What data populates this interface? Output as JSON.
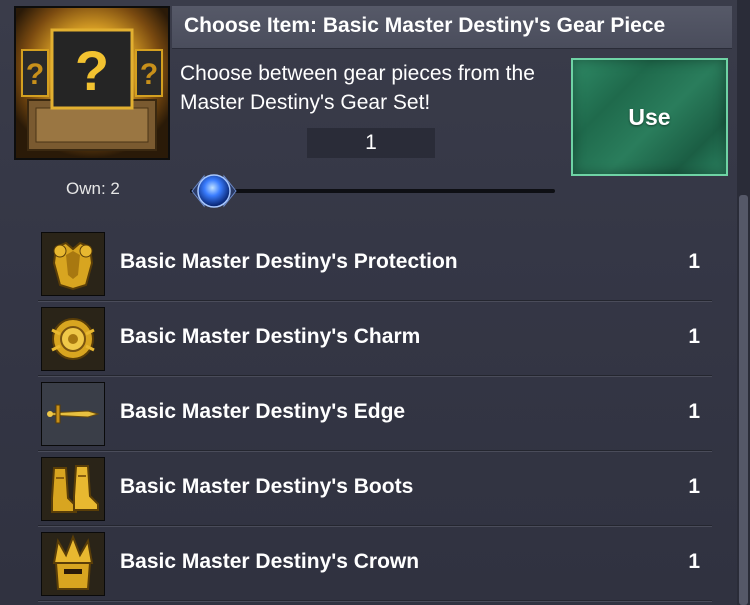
{
  "header": {
    "title": "Choose Item: Basic Master Destiny's Gear Piece"
  },
  "description": "Choose between gear pieces from the Master Destiny's Gear Set!",
  "quantity": "1",
  "use_button": {
    "label": "Use"
  },
  "own": {
    "label": "Own: 2"
  },
  "slider": {
    "value": 1,
    "max": 2
  },
  "items": [
    {
      "name": "Basic Master Destiny's Protection",
      "count": "1",
      "icon": "armor-icon"
    },
    {
      "name": "Basic Master Destiny's Charm",
      "count": "1",
      "icon": "charm-icon"
    },
    {
      "name": "Basic Master Destiny's Edge",
      "count": "1",
      "icon": "sword-icon"
    },
    {
      "name": "Basic Master Destiny's Boots",
      "count": "1",
      "icon": "boots-icon"
    },
    {
      "name": "Basic Master Destiny's Crown",
      "count": "1",
      "icon": "crown-icon"
    }
  ],
  "colors": {
    "panel": "#353746",
    "header": "#4a4d5c",
    "use_button": "#2a7d5c",
    "gold": "#e0b22a",
    "slider_knob": "#3a7dff"
  }
}
